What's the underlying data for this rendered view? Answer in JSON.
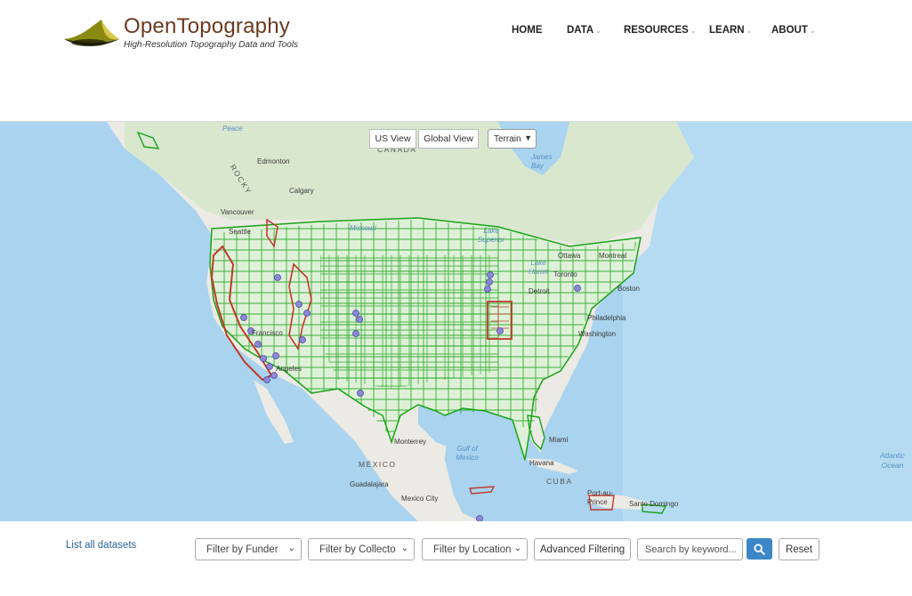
{
  "brand": {
    "title": "OpenTopography",
    "tagline": "High-Resolution Topography Data and Tools"
  },
  "nav": [
    {
      "label": "HOME",
      "has_caret": false
    },
    {
      "label": "DATA",
      "has_caret": true
    },
    {
      "label": "RESOURCES",
      "has_caret": true
    },
    {
      "label": "LEARN",
      "has_caret": true
    },
    {
      "label": "ABOUT",
      "has_caret": true
    }
  ],
  "map_controls": {
    "us_view": "US View",
    "global_view": "Global View",
    "basemap_value": "Terrain"
  },
  "map_labels": {
    "edmonton": "Edmonton",
    "calgary": "Calgary",
    "vancouver": "Vancouver",
    "seattle": "Seattle",
    "ottawa": "Ottawa",
    "montreal": "Montreal",
    "toronto": "Toronto",
    "boston": "Boston",
    "detroit": "Detroit",
    "philadelphia": "Philadelphia",
    "washington": "Washington",
    "miami": "Miami",
    "havana": "Havana",
    "cuba": "CUBA",
    "monterrey": "Monterrey",
    "mexico": "MÉXICO",
    "guadalajara": "Guadalajara",
    "mexico_city": "Mexico City",
    "san_francisco": "Francisco",
    "los_angeles": "Angeles",
    "port_au_prince": "Port-au-Prince",
    "santo_domingo": "Santo Domingo",
    "james_bay": "James Bay",
    "lake_superior": "Lake Superior",
    "lake_huron": "Lake Huron",
    "gulf_of_mexico": "Gulf of Mexico",
    "atlantic_ocean": "Atlantic Ocean",
    "rocky": "ROCKY",
    "canada": "CANADA",
    "peace": "Peace",
    "missouri": "Missouri"
  },
  "colors": {
    "dataset_green": "#19a319",
    "dataset_red": "#c0392b",
    "point_purple": "#8c87d8",
    "water": "#a9d3ee",
    "land": "#eceae4",
    "search_button": "#3b87c8",
    "brand_brown": "#6b3a1f"
  },
  "footer": {
    "list_all": "List all datasets",
    "filter_funder": "Filter by Funder",
    "filter_collector": "Filter by Collecto",
    "filter_location": "Filter by Location",
    "advanced_filtering": "Advanced Filtering",
    "search_placeholder": "Search by keyword...",
    "reset": "Reset",
    "search_icon": "search-icon"
  }
}
